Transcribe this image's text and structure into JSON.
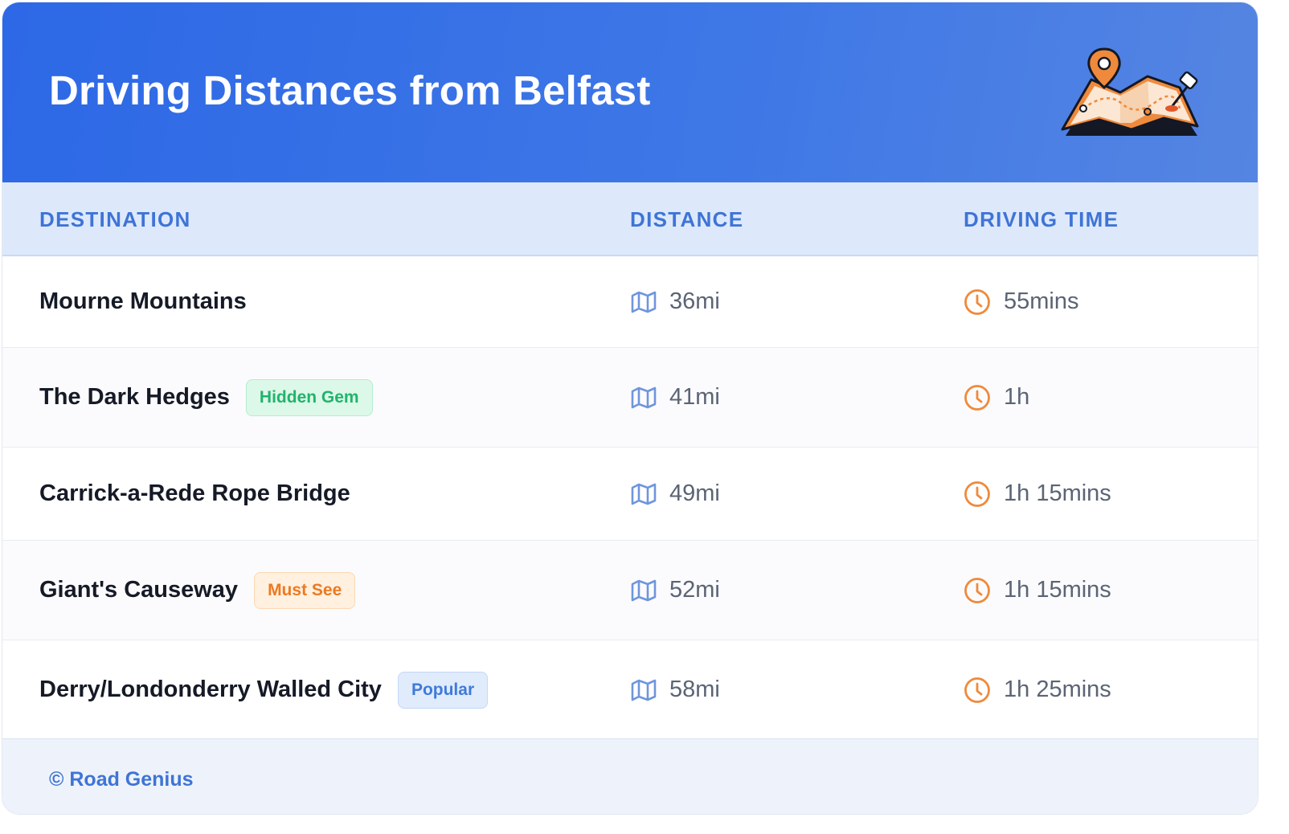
{
  "header": {
    "title": "Driving Distances from Belfast",
    "illustration": "map-with-pins-icon"
  },
  "table": {
    "columns": [
      "DESTINATION",
      "DISTANCE",
      "DRIVING TIME"
    ],
    "rows": [
      {
        "destination": "Mourne Mountains",
        "badge": null,
        "distance": "36mi",
        "time": "55mins"
      },
      {
        "destination": "The Dark Hedges",
        "badge": "Hidden Gem",
        "badge_style": "green",
        "distance": "41mi",
        "time": "1h"
      },
      {
        "destination": "Carrick-a-Rede Rope Bridge",
        "badge": null,
        "distance": "49mi",
        "time": "1h 15mins"
      },
      {
        "destination": "Giant's Causeway",
        "badge": "Must See",
        "badge_style": "orange",
        "distance": "52mi",
        "time": "1h 15mins"
      },
      {
        "destination": "Derry/Londonderry Walled City",
        "badge": "Popular",
        "badge_style": "blue",
        "distance": "58mi",
        "time": "1h 25mins"
      }
    ]
  },
  "icons": {
    "distance": "map-icon",
    "time": "clock-icon"
  },
  "colors": {
    "header_start": "#2d68e6",
    "header_end": "#5585e2",
    "accent_blue": "#3f74d6",
    "accent_orange": "#ef8a3c",
    "badge_green_text": "#22b36b",
    "badge_green_bg": "#dcf8e9",
    "badge_green_border": "#b6ecd0",
    "badge_orange_text": "#ec7a22",
    "badge_orange_bg": "#fff0df",
    "badge_orange_border": "#fbd8b3",
    "badge_blue_text": "#3f7ad9",
    "badge_blue_bg": "#e0ebfc",
    "badge_blue_border": "#c4d8f7"
  },
  "footer": {
    "text": "© Road Genius"
  }
}
